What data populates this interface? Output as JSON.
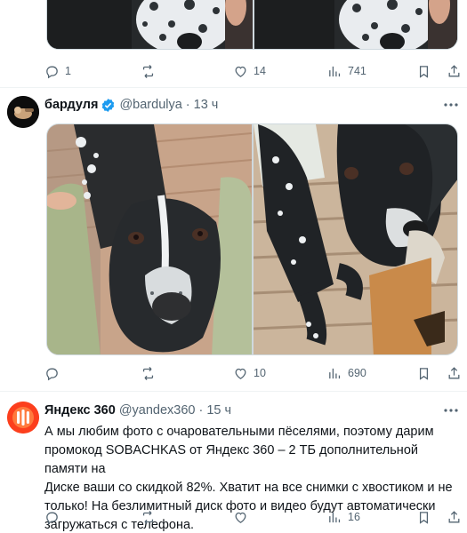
{
  "colors": {
    "text_primary": "#0f1419",
    "text_secondary": "#536471",
    "verified_blue": "#1d9bf0",
    "divider": "#eff3f4",
    "yandex_orange": "#fc3f1d"
  },
  "tweet_top": {
    "actions": {
      "reply": {
        "icon": "reply-icon",
        "count": "1"
      },
      "retweet": {
        "icon": "retweet-icon",
        "count": ""
      },
      "like": {
        "icon": "heart-icon",
        "count": "14"
      },
      "views": {
        "icon": "views-icon",
        "count": "741"
      },
      "bookmark": {
        "icon": "bookmark-icon"
      },
      "share": {
        "icon": "share-icon"
      }
    }
  },
  "tweet_bardulya": {
    "author": {
      "display_name": "бардуля",
      "handle": "@bardulya",
      "separator": "·",
      "time": "13 ч",
      "verified": true
    },
    "actions": {
      "reply": {
        "icon": "reply-icon",
        "count": ""
      },
      "retweet": {
        "icon": "retweet-icon",
        "count": ""
      },
      "like": {
        "icon": "heart-icon",
        "count": "10"
      },
      "views": {
        "icon": "views-icon",
        "count": "690"
      },
      "bookmark": {
        "icon": "bookmark-icon"
      },
      "share": {
        "icon": "share-icon"
      }
    }
  },
  "tweet_yandex": {
    "author": {
      "display_name": "Яндекс 360",
      "handle": "@yandex360",
      "separator": "·",
      "time": "15 ч",
      "verified": false
    },
    "text_lines": [
      "А мы любим фото с очаровательными пёселями, поэтому дарим",
      "промокод SOBACHKAS от Яндекс 360 – 2 ТБ дополнительной памяти на",
      "Диске ваши со скидкой 82%. Хватит на все снимки с хвостиком и не",
      "только! На безлимитный диск фото и видео будут автоматически",
      "загружаться с телефона."
    ],
    "actions": {
      "reply": {
        "icon": "reply-icon",
        "count": ""
      },
      "retweet": {
        "icon": "retweet-icon",
        "count": ""
      },
      "like": {
        "icon": "heart-icon",
        "count": ""
      },
      "views": {
        "icon": "views-icon",
        "count": "16"
      },
      "bookmark": {
        "icon": "bookmark-icon"
      },
      "share": {
        "icon": "share-icon"
      }
    }
  }
}
